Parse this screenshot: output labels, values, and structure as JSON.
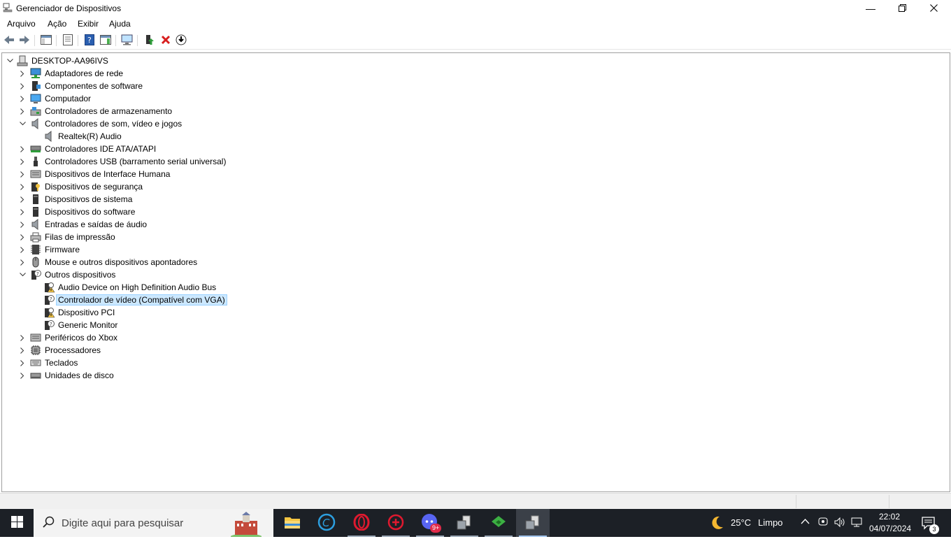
{
  "window": {
    "title": "Gerenciador de Dispositivos"
  },
  "menu": [
    {
      "label": "Arquivo"
    },
    {
      "label": "Ação"
    },
    {
      "label": "Exibir"
    },
    {
      "label": "Ajuda"
    }
  ],
  "tree": {
    "root": "DESKTOP-AA96IVS",
    "rows": [
      {
        "label": "Adaptadores de rede"
      },
      {
        "label": "Componentes de software"
      },
      {
        "label": "Computador"
      },
      {
        "label": "Controladores de armazenamento"
      },
      {
        "label": "Controladores de som, vídeo e jogos"
      },
      {
        "label": "Realtek(R) Audio"
      },
      {
        "label": "Controladores IDE ATA/ATAPI"
      },
      {
        "label": "Controladores USB (barramento serial universal)"
      },
      {
        "label": "Dispositivos de Interface Humana"
      },
      {
        "label": "Dispositivos de segurança"
      },
      {
        "label": "Dispositivos de sistema"
      },
      {
        "label": "Dispositivos do software"
      },
      {
        "label": "Entradas e saídas de áudio"
      },
      {
        "label": "Filas de impressão"
      },
      {
        "label": "Firmware"
      },
      {
        "label": "Mouse e outros dispositivos apontadores"
      },
      {
        "label": "Outros dispositivos"
      },
      {
        "label": "Audio Device on High Definition Audio Bus"
      },
      {
        "label": "Controlador de vídeo (Compatível com VGA)"
      },
      {
        "label": "Dispositivo PCI"
      },
      {
        "label": "Generic Monitor"
      },
      {
        "label": "Periféricos do Xbox"
      },
      {
        "label": "Processadores"
      },
      {
        "label": "Teclados"
      },
      {
        "label": "Unidades de disco"
      }
    ]
  },
  "taskbar": {
    "search_placeholder": "Digite aqui para pesquisar",
    "discord_badge": "9+",
    "weather_temp": "25°C",
    "weather_text": "Limpo",
    "time": "22:02",
    "date": "04/07/2024",
    "notification_count": "3"
  },
  "colors": {
    "selection": "#cce8ff",
    "taskbar": "#1c2026",
    "accent": "#0078d7"
  }
}
